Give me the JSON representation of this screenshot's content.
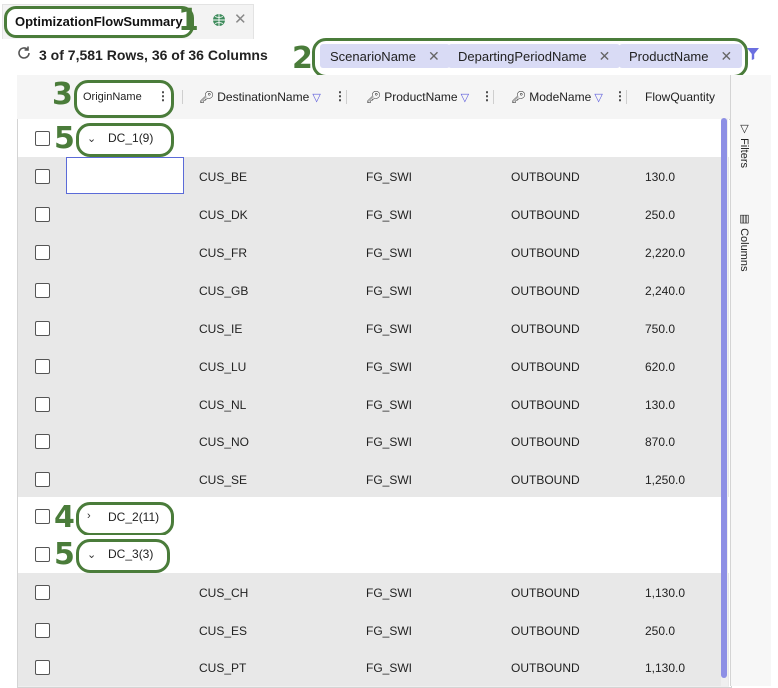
{
  "tab": {
    "title": "OptimizationFlowSummary",
    "callout": "1"
  },
  "toolbar": {
    "row_count": "3 of 7,581 Rows, 36 of 36 Columns",
    "callout": "2"
  },
  "group_chips": [
    "ScenarioName",
    "DepartingPeriodName",
    "ProductName"
  ],
  "header": {
    "callout": "3",
    "columns": [
      "OriginName",
      "DestinationName",
      "ProductName",
      "ModeName",
      "FlowQuantity"
    ]
  },
  "groups": [
    {
      "label": "DC_1",
      "count": "(9)",
      "expanded": true,
      "callout": "5"
    },
    {
      "label": "DC_2",
      "count": "(11)",
      "expanded": false,
      "callout": "4"
    },
    {
      "label": "DC_3",
      "count": "(3)",
      "expanded": true,
      "callout": "5"
    }
  ],
  "rows": [
    {
      "destination": "CUS_BE",
      "product": "FG_SWI",
      "mode": "OUTBOUND",
      "flow": "130.0"
    },
    {
      "destination": "CUS_DK",
      "product": "FG_SWI",
      "mode": "OUTBOUND",
      "flow": "250.0"
    },
    {
      "destination": "CUS_FR",
      "product": "FG_SWI",
      "mode": "OUTBOUND",
      "flow": "2,220.0"
    },
    {
      "destination": "CUS_GB",
      "product": "FG_SWI",
      "mode": "OUTBOUND",
      "flow": "2,240.0"
    },
    {
      "destination": "CUS_IE",
      "product": "FG_SWI",
      "mode": "OUTBOUND",
      "flow": "750.0"
    },
    {
      "destination": "CUS_LU",
      "product": "FG_SWI",
      "mode": "OUTBOUND",
      "flow": "620.0"
    },
    {
      "destination": "CUS_NL",
      "product": "FG_SWI",
      "mode": "OUTBOUND",
      "flow": "130.0"
    },
    {
      "destination": "CUS_NO",
      "product": "FG_SWI",
      "mode": "OUTBOUND",
      "flow": "870.0"
    },
    {
      "destination": "CUS_SE",
      "product": "FG_SWI",
      "mode": "OUTBOUND",
      "flow": "1,250.0"
    },
    {
      "destination": "CUS_CH",
      "product": "FG_SWI",
      "mode": "OUTBOUND",
      "flow": "1,130.0"
    },
    {
      "destination": "CUS_ES",
      "product": "FG_SWI",
      "mode": "OUTBOUND",
      "flow": "250.0"
    },
    {
      "destination": "CUS_PT",
      "product": "FG_SWI",
      "mode": "OUTBOUND",
      "flow": "1,130.0"
    }
  ],
  "side_panel": {
    "filters": "Filters",
    "columns": "Columns"
  },
  "icons": {
    "refresh": "refresh-icon",
    "globe": "globe-icon",
    "close": "close-icon",
    "key": "key-icon",
    "filter": "filter-icon",
    "menu": "column-menu-icon",
    "chevron_down": "chevron-down-icon",
    "chevron_right": "chevron-right-icon"
  },
  "colors": {
    "callout_green": "#4a7c3a",
    "chip_bg": "#d9dbf5",
    "accent": "#5b6bd8",
    "row_bg": "#e8e8e8"
  }
}
